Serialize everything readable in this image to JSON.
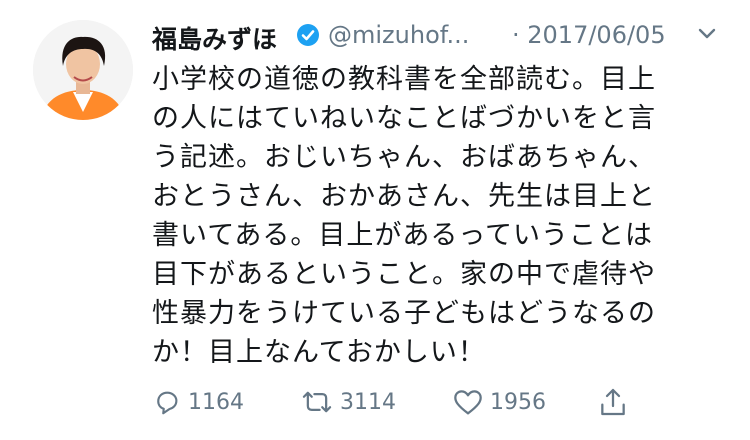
{
  "tweet": {
    "author_name": "福島みずほ",
    "handle": "@mizuhof...",
    "date": "· 2017/06/05",
    "lines": [
      "小学校の道徳の教科書を全部読む。目上",
      "の人にはていねいなことばづかいをと言",
      "う記述。おじいちゃん、おばあちゃん、",
      "おとうさん、おかあさん、先生は目上と",
      "書いてある。目上があるっていうことは",
      "目下があるということ。家の中で虐待や",
      "性暴力をうけている子どもはどうなるの",
      "か！目上なんておかしい！"
    ]
  },
  "actions": {
    "reply_count": "1164",
    "retweet_count": "3114",
    "like_count": "1956"
  },
  "icons": {
    "avatar": "avatar-photo",
    "verified": "verified-badge-icon",
    "more": "chevron-down-icon",
    "reply": "reply-icon",
    "retweet": "retweet-icon",
    "like": "heart-icon",
    "share": "share-icon"
  },
  "colors": {
    "text": "#14171a",
    "muted": "#657786",
    "verified": "#1da1f2",
    "avatar_top": "#ff8a2a"
  }
}
